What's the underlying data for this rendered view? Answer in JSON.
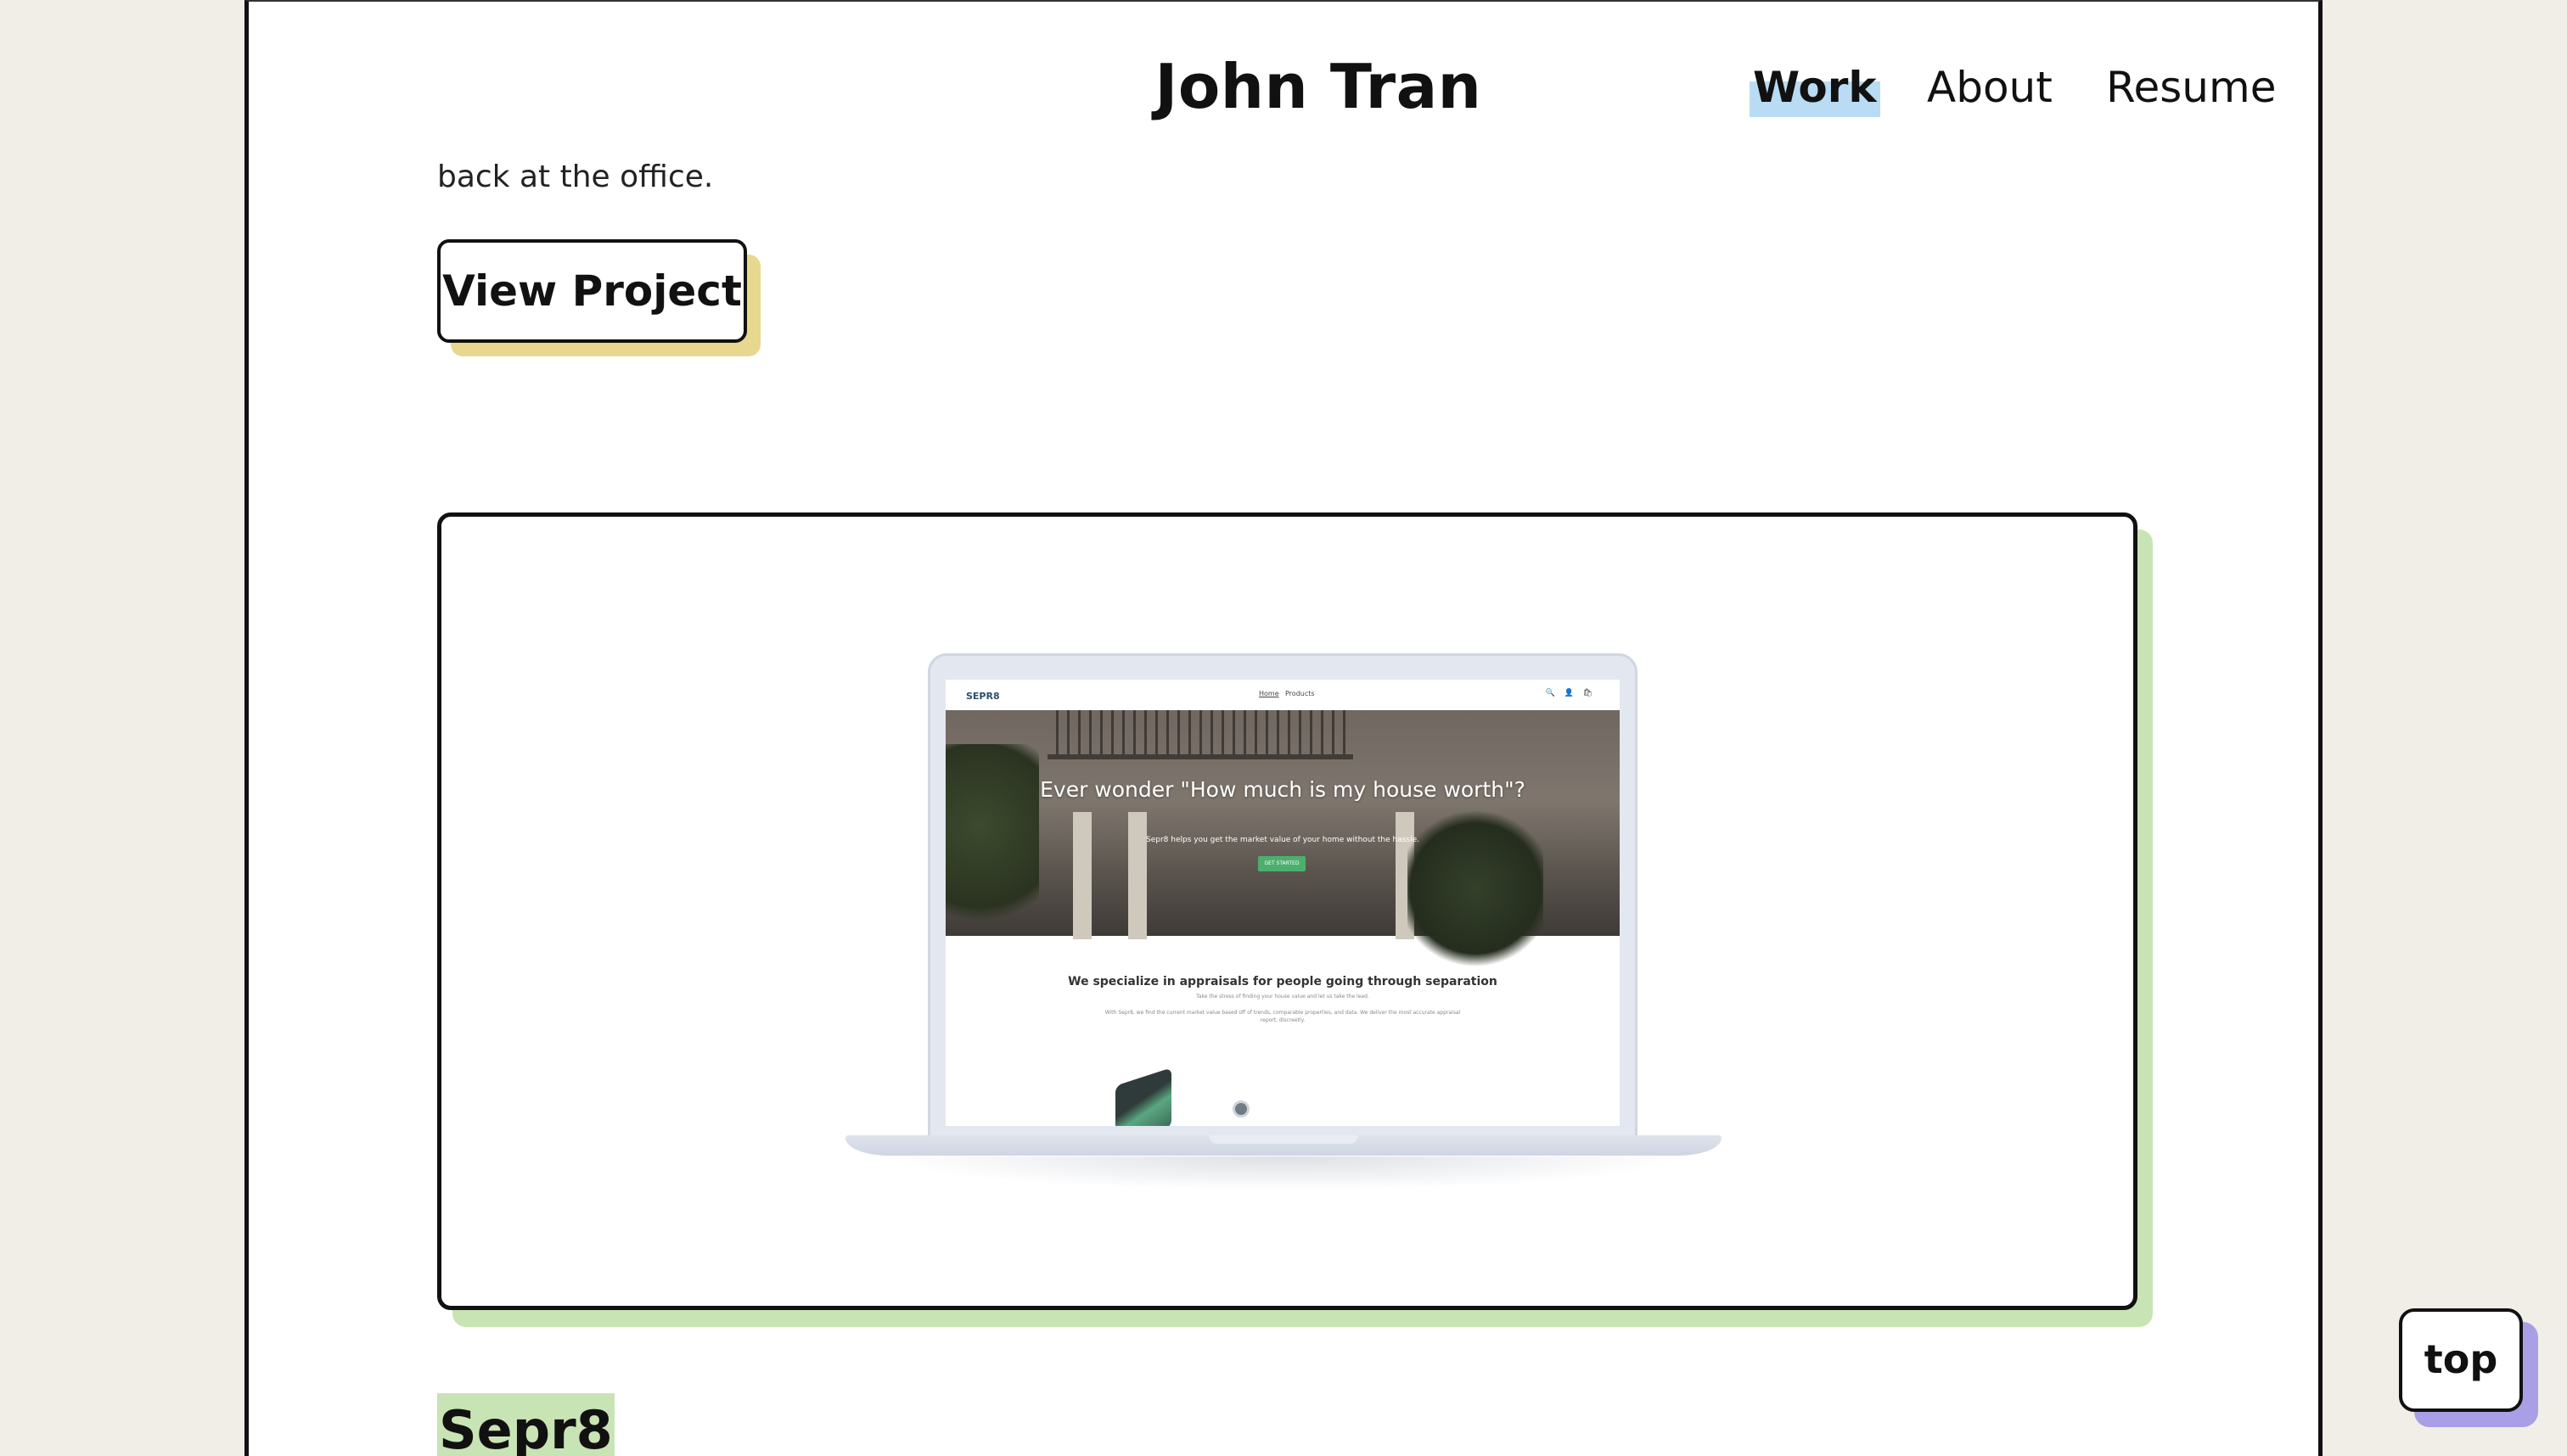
{
  "header": {
    "site_name": "John Tran",
    "nav": {
      "work": "Work",
      "about": "About",
      "resume": "Resume"
    }
  },
  "previous_project": {
    "cut_text": "back at the office.",
    "view_project_label": "View Project"
  },
  "project": {
    "mockup": {
      "logo": "SEPR8",
      "nav_home": "Home",
      "nav_products": "Products",
      "icons": "🔍 👤 🛍",
      "hero_title": "Ever wonder \"How much is my house worth\"?",
      "hero_subtitle": "Sepr8 helps you get the market value of your home without the hassle.",
      "hero_cta": "GET STARTED",
      "content_title": "We specialize in appraisals for people going through separation",
      "content_p1": "Take the stress of finding your house value and let us take the lead.",
      "content_p2": "With Sepr8, we find the current market value based off of trends, comparable properties, and data. We deliver the most accurate appraisal report, discreetly."
    },
    "title": "Sepr8"
  },
  "scroll_top_label": "top",
  "colors": {
    "background": "#f1eee7",
    "work_highlight": "#b9dcf4",
    "view_project_shadow": "#e8d78e",
    "card_shadow": "#c9e4b4",
    "top_shadow": "#a89fe6"
  }
}
